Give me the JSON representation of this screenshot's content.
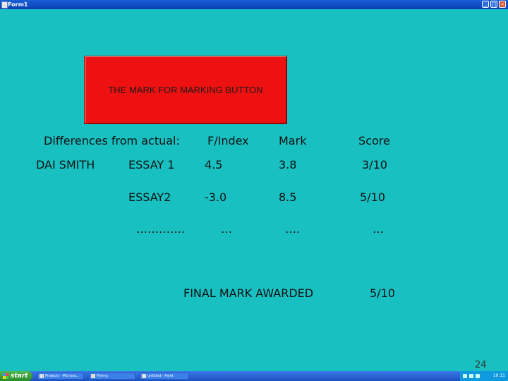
{
  "window": {
    "title": "Form1"
  },
  "button": {
    "label": "THE MARK FOR MARKING BUTTON"
  },
  "table": {
    "caption": "Differences from actual:",
    "headers": [
      "F/Index",
      "Mark",
      "Score"
    ],
    "student": "DAI SMITH",
    "rows": [
      {
        "item": "ESSAY 1",
        "findex": "4.5",
        "mark": "3.8",
        "score": "3/10"
      },
      {
        "item": "ESSAY2",
        "findex": "-3.0",
        "mark": "8.5",
        "score": "5/10"
      },
      {
        "item": "………….",
        "findex": "…",
        "mark": "….",
        "score": "…"
      }
    ],
    "final_label": "FINAL MARK AWARDED",
    "final_score": "5/10"
  },
  "slide_number": "24",
  "taskbar": {
    "start_label": "start",
    "tasks": [
      "Projects - Microso...",
      "Pjmng",
      "untitled - Paint"
    ],
    "clock": "10:11"
  }
}
